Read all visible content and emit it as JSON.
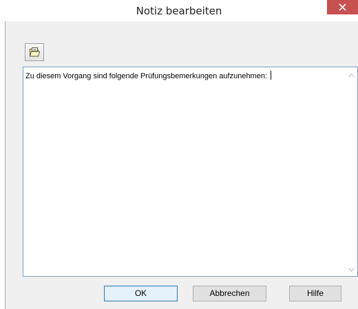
{
  "window": {
    "title": "Notiz bearbeiten",
    "close_icon": "close-icon"
  },
  "toolbar": {
    "open_icon": "folder-open-icon"
  },
  "note": {
    "text": "Zu diesem Vorgang sind folgende Prüfungsbemerkungen aufzunehmen: "
  },
  "buttons": {
    "ok_label": "OK",
    "cancel_label": "Abbrechen",
    "help_label": "Hilfe"
  },
  "colors": {
    "close_button": "#c75050",
    "default_button_border": "#3c7fb1",
    "textarea_border": "#7a9bc4"
  }
}
